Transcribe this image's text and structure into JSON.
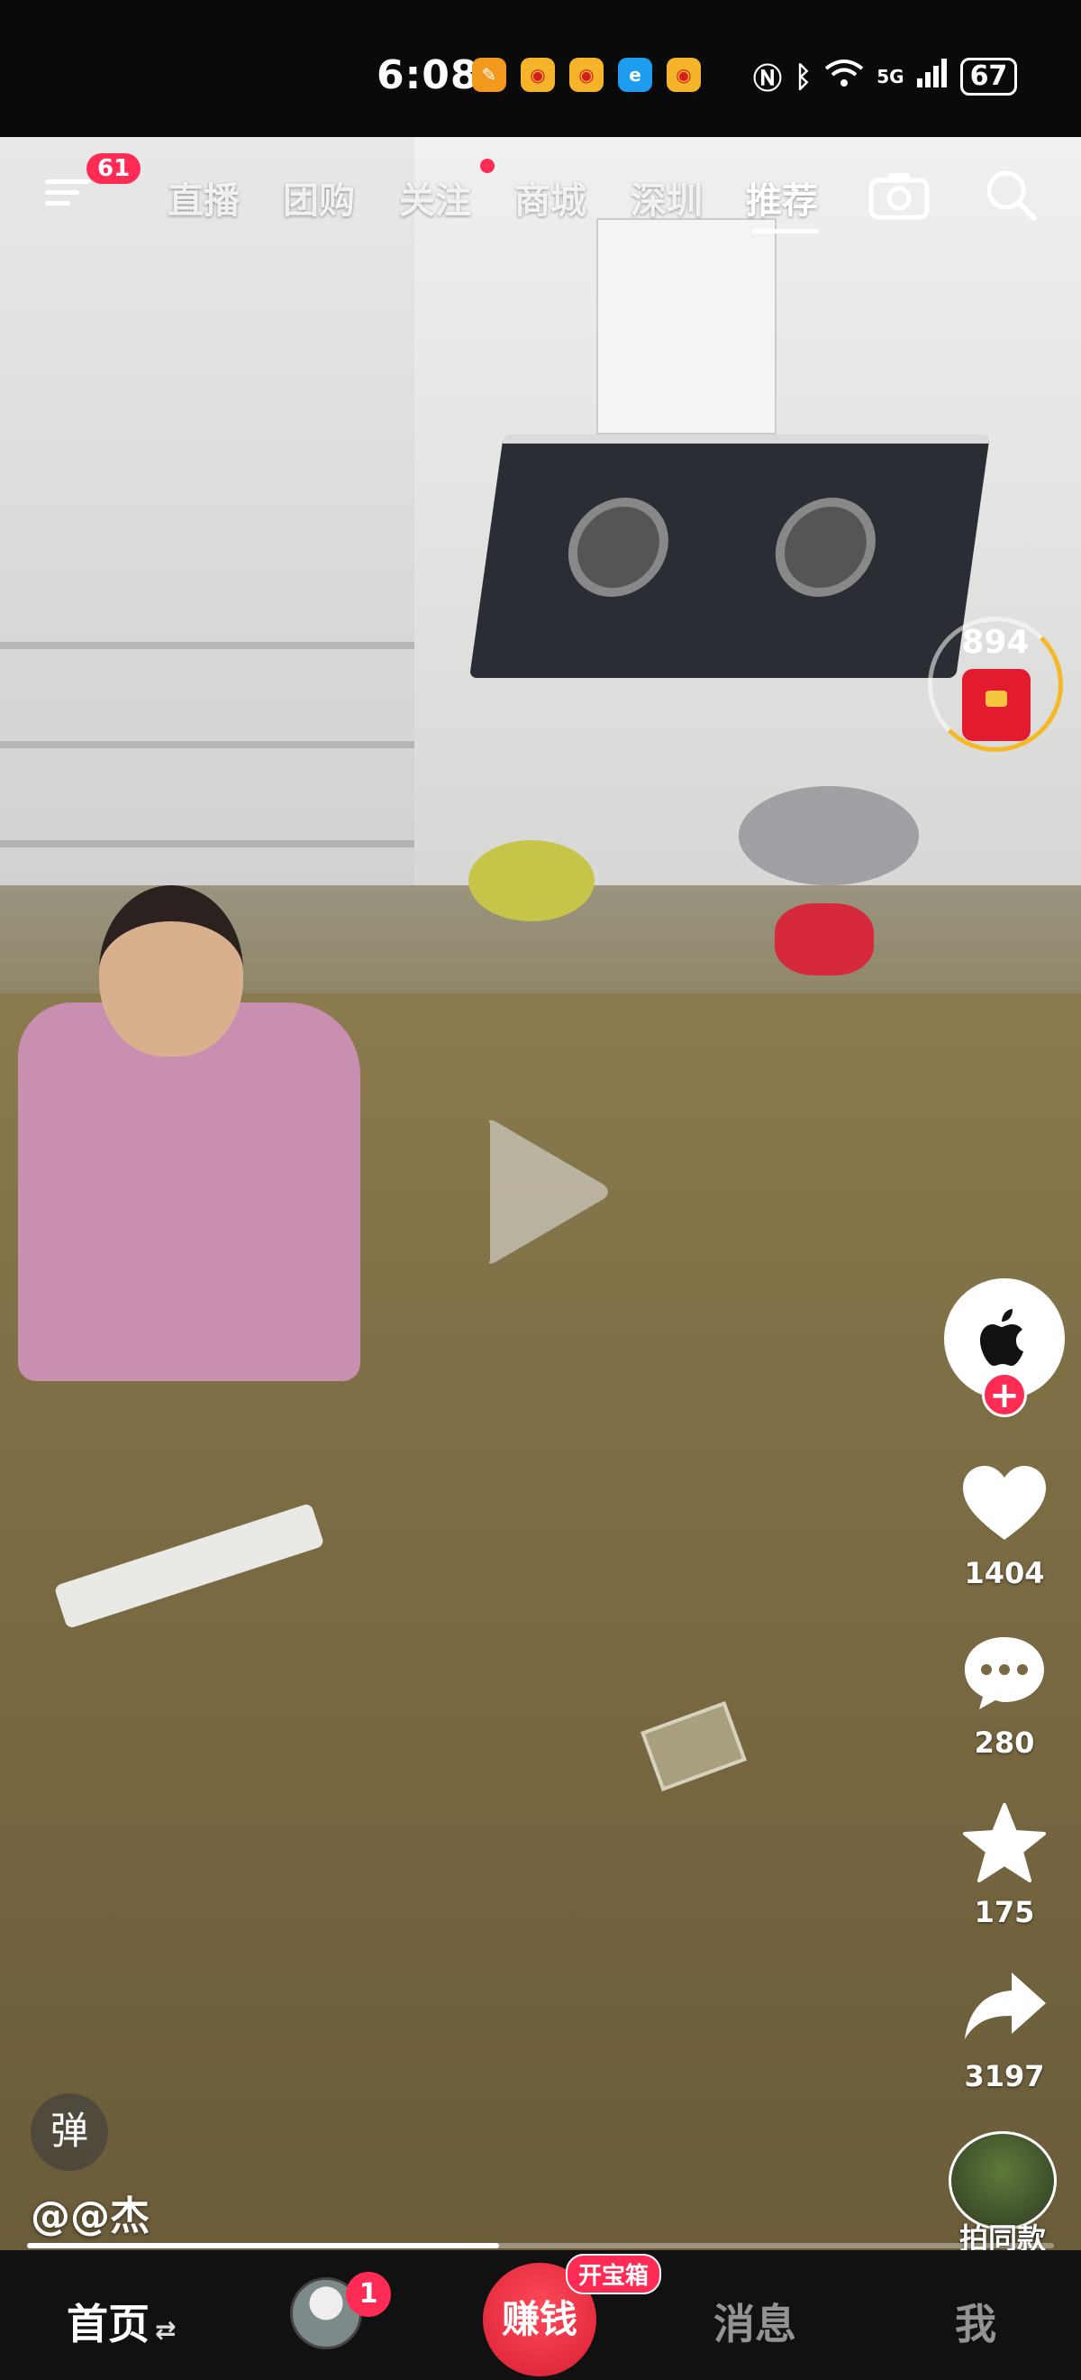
{
  "status_bar": {
    "time": "6:08",
    "battery": "67",
    "network": "5G",
    "app_icons": [
      "notes-app-icon",
      "weibo-icon",
      "weibo-icon",
      "browser-app-icon",
      "weibo-icon"
    ]
  },
  "top_nav": {
    "menu_badge": "61",
    "tabs": [
      {
        "label": "直播"
      },
      {
        "label": "团购"
      },
      {
        "label": "关注"
      },
      {
        "label": "商城"
      },
      {
        "label": "深圳"
      },
      {
        "label": "推荐",
        "active": true
      }
    ]
  },
  "coin_widget": {
    "count": "894"
  },
  "rail": {
    "likes": "1404",
    "comments": "280",
    "favorites": "175",
    "shares": "3197",
    "same_style_label": "拍同款"
  },
  "video": {
    "author": "@@杰",
    "danmu_label": "弹",
    "progress": 0.46
  },
  "bottom_nav": {
    "home_label": "首页",
    "home_arrow": "⇄",
    "friends_badge": "1",
    "earn_label": "赚钱",
    "earn_tag": "开宝箱",
    "messages_label": "消息",
    "me_label": "我"
  },
  "colors": {
    "accent": "#fe2c55",
    "coin_ring": "#f5b928"
  }
}
